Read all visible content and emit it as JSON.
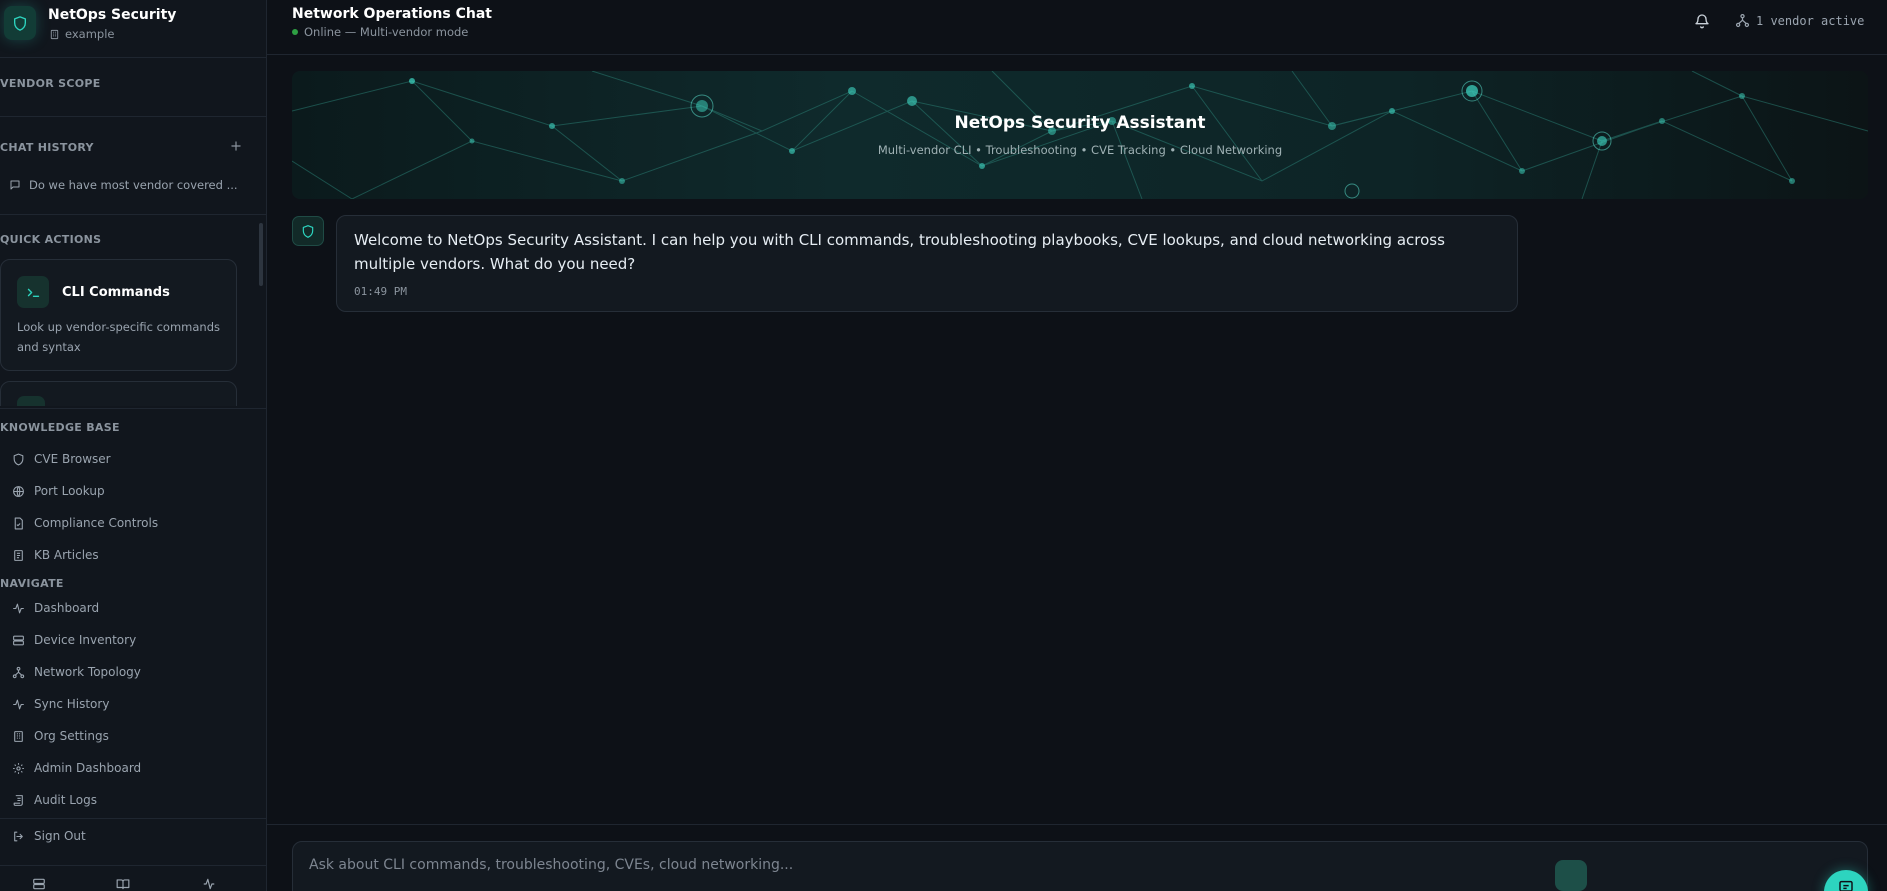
{
  "brand": {
    "title": "NetOps Security",
    "org": "example"
  },
  "sidebar": {
    "vendor_scope_label": "VENDOR SCOPE",
    "chat_history_label": "CHAT HISTORY",
    "chat_history": [
      {
        "label": "Do we have most vendor covered ..."
      }
    ],
    "quick_actions_label": "QUICK ACTIONS",
    "quick_actions": [
      {
        "title": "CLI Commands",
        "description": "Look up vendor-specific commands and syntax",
        "icon": "terminal-icon"
      }
    ],
    "knowledge_base_label": "KNOWLEDGE BASE",
    "knowledge_base": [
      {
        "label": "CVE Browser",
        "icon": "shield-icon"
      },
      {
        "label": "Port Lookup",
        "icon": "globe-icon"
      },
      {
        "label": "Compliance Controls",
        "icon": "file-check-icon"
      },
      {
        "label": "KB Articles",
        "icon": "book-icon"
      }
    ],
    "navigate_label": "NAVIGATE",
    "navigate": [
      {
        "label": "Dashboard",
        "icon": "activity-icon"
      },
      {
        "label": "Device Inventory",
        "icon": "server-icon"
      },
      {
        "label": "Network Topology",
        "icon": "topology-icon"
      },
      {
        "label": "Sync History",
        "icon": "activity-icon"
      },
      {
        "label": "Org Settings",
        "icon": "building-icon"
      },
      {
        "label": "Admin Dashboard",
        "icon": "gear-icon"
      },
      {
        "label": "Audit Logs",
        "icon": "scroll-icon"
      }
    ],
    "sign_out_label": "Sign Out"
  },
  "header": {
    "title": "Network Operations Chat",
    "status": "Online — Multi-vendor mode",
    "vendor_active": "1 vendor active"
  },
  "banner": {
    "title": "NetOps Security Assistant",
    "subtitle": "Multi-vendor CLI • Troubleshooting • CVE Tracking • Cloud Networking"
  },
  "messages": [
    {
      "text": "Welcome to NetOps Security Assistant. I can help you with CLI commands, troubleshooting playbooks, CVE lookups, and cloud networking across multiple vendors. What do you need?",
      "time": "01:49 PM"
    }
  ],
  "composer": {
    "placeholder": "Ask about CLI commands, troubleshooting, CVEs, cloud networking..."
  },
  "colors": {
    "accent": "#2dd4bf",
    "background": "#0d1117",
    "sidebar": "#11161d",
    "online": "#2ea043"
  }
}
